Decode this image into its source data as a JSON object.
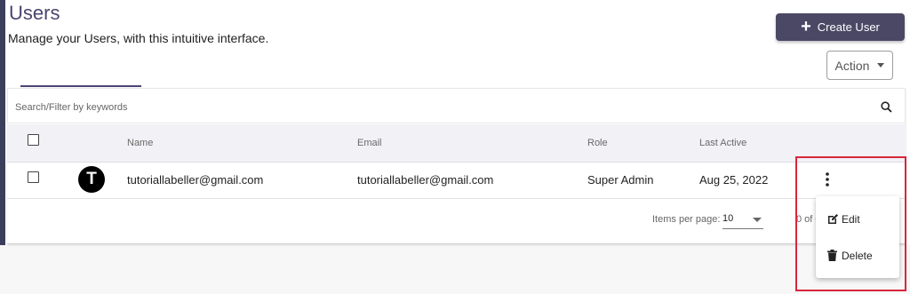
{
  "header": {
    "title": "Users",
    "subtitle": "Manage your Users, with this intuitive interface.",
    "create_button_label": "Create User",
    "action_button_label": "Action"
  },
  "search": {
    "placeholder": "Search/Filter by keywords",
    "value": ""
  },
  "table": {
    "columns": [
      "Name",
      "Email",
      "Role",
      "Last Active"
    ],
    "rows": [
      {
        "avatar_initial": "T",
        "name": "tutoriallabeller@gmail.com",
        "email": "tutoriallabeller@gmail.com",
        "role": "Super Admin",
        "last_active": "Aug 25, 2022"
      }
    ]
  },
  "pagination": {
    "items_per_page_label": "Items per page:",
    "items_per_page_value": "10",
    "range_label": "0 of 0"
  },
  "row_menu": {
    "items": [
      {
        "label": "Edit",
        "icon": "edit-icon"
      },
      {
        "label": "Delete",
        "icon": "trash-icon"
      }
    ]
  },
  "colors": {
    "accent": "#4b4866",
    "highlight": "#d9263b"
  }
}
